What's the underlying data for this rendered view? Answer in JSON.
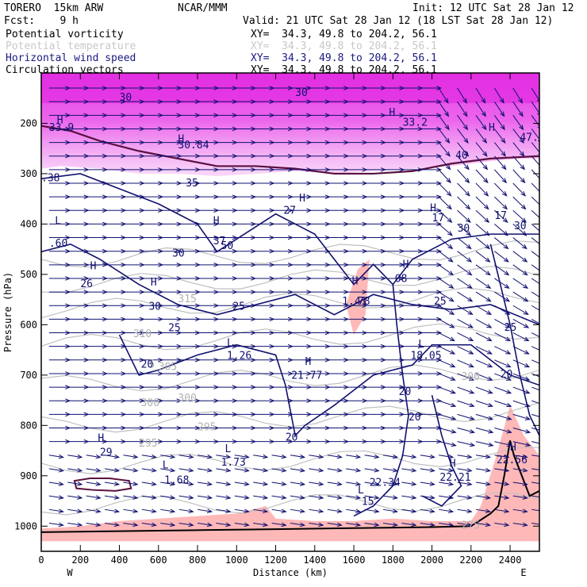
{
  "header": {
    "model": "TORERO  15km ARW",
    "fcst": "Fcst:    9 h",
    "center": "NCAR/MMM",
    "init": "Init: 12 UTC Sat 28 Jan 12",
    "valid": "Valid: 21 UTC Sat 28 Jan 12 (18 LST Sat 28 Jan 12)"
  },
  "legend": [
    {
      "label": "Potential vorticity",
      "xy": "XY=  34.3, 49.8 to 204.2, 56.1",
      "color": "#000000"
    },
    {
      "label": "Potential temperature",
      "xy": "XY=  34.3, 49.8 to 204.2, 56.1",
      "color": "#c8c8c8"
    },
    {
      "label": "Horizontal wind speed",
      "xy": "XY=  34.3, 49.8 to 204.2, 56.1",
      "color": "#1a1a80"
    },
    {
      "label": "Circulation vectors",
      "xy": "XY=  34.3, 49.8 to 204.2, 56.1",
      "color": "#000000"
    }
  ],
  "colors": {
    "pv_high": "#e020e0",
    "pv_low": "#ffb0b0",
    "wind": "#101070",
    "theta": "#c0c0c0",
    "terrain": "#000000"
  },
  "chart_data": {
    "type": "cross-section",
    "xlabel": "Distance (km)",
    "ylabel": "Pressure (hPa)",
    "xlim": [
      0,
      2550
    ],
    "ylim": [
      1050,
      100
    ],
    "x_ticks": [
      0,
      200,
      400,
      600,
      800,
      1000,
      1200,
      1400,
      1600,
      1800,
      2000,
      2200,
      2400
    ],
    "y_ticks": [
      200,
      300,
      400,
      500,
      600,
      700,
      800,
      900,
      1000
    ],
    "endpoint_left": "W",
    "endpoint_right": "E",
    "wind_contour_labels": [
      {
        "x": 400,
        "p": 155,
        "text": "30"
      },
      {
        "x": 1300,
        "p": 146,
        "text": "30"
      },
      {
        "x": 1850,
        "p": 205,
        "text": "33.2"
      },
      {
        "x": 40,
        "p": 215,
        "text": "33.9"
      },
      {
        "x": 700,
        "p": 250,
        "text": "30.84"
      },
      {
        "x": 2450,
        "p": 235,
        "text": "47.06"
      },
      {
        "x": 2120,
        "p": 270,
        "text": "40"
      },
      {
        "x": 0,
        "p": 315,
        "text": ".38"
      },
      {
        "x": 740,
        "p": 325,
        "text": "35"
      },
      {
        "x": 1240,
        "p": 380,
        "text": "27"
      },
      {
        "x": 2000,
        "p": 395,
        "text": "17"
      },
      {
        "x": 2320,
        "p": 390,
        "text": "17"
      },
      {
        "x": 2130,
        "p": 415,
        "text": "30"
      },
      {
        "x": 2420,
        "p": 410,
        "text": "30"
      },
      {
        "x": 40,
        "p": 445,
        "text": ".60"
      },
      {
        "x": 880,
        "p": 440,
        "text": "37"
      },
      {
        "x": 920,
        "p": 450,
        "text": "50"
      },
      {
        "x": 670,
        "p": 465,
        "text": "30"
      },
      {
        "x": 1810,
        "p": 515,
        "text": "08"
      },
      {
        "x": 200,
        "p": 525,
        "text": "26"
      },
      {
        "x": 1540,
        "p": 560,
        "text": "1.41"
      },
      {
        "x": 1620,
        "p": 560,
        "text": "78"
      },
      {
        "x": 980,
        "p": 570,
        "text": "25"
      },
      {
        "x": 550,
        "p": 570,
        "text": "30"
      },
      {
        "x": 2010,
        "p": 560,
        "text": "25"
      },
      {
        "x": 2370,
        "p": 612,
        "text": "25"
      },
      {
        "x": 650,
        "p": 613,
        "text": "25"
      },
      {
        "x": 950,
        "p": 668,
        "text": "1.26"
      },
      {
        "x": 1890,
        "p": 668,
        "text": "18.05"
      },
      {
        "x": 510,
        "p": 685,
        "text": "20"
      },
      {
        "x": 1280,
        "p": 707,
        "text": "21.77"
      },
      {
        "x": 2350,
        "p": 705,
        "text": "20"
      },
      {
        "x": 1830,
        "p": 740,
        "text": "20"
      },
      {
        "x": 1880,
        "p": 790,
        "text": "20"
      },
      {
        "x": 1250,
        "p": 830,
        "text": "20"
      },
      {
        "x": 300,
        "p": 860,
        "text": "29"
      },
      {
        "x": 920,
        "p": 880,
        "text": "1.73"
      },
      {
        "x": 630,
        "p": 915,
        "text": "1.68"
      },
      {
        "x": 2330,
        "p": 875,
        "text": "22.56"
      },
      {
        "x": 1680,
        "p": 920,
        "text": "22.34"
      },
      {
        "x": 2040,
        "p": 910,
        "text": "22.21"
      },
      {
        "x": 1640,
        "p": 958,
        "text": "15"
      }
    ],
    "theta_contour_labels": [
      {
        "x": 700,
        "p": 555,
        "text": "315"
      },
      {
        "x": 470,
        "p": 625,
        "text": "310"
      },
      {
        "x": 600,
        "p": 690,
        "text": "305"
      },
      {
        "x": 550,
        "p": 685,
        "text": "5"
      },
      {
        "x": 510,
        "p": 762,
        "text": "300"
      },
      {
        "x": 700,
        "p": 752,
        "text": "300"
      },
      {
        "x": 800,
        "p": 810,
        "text": "295"
      },
      {
        "x": 500,
        "p": 842,
        "text": "295"
      },
      {
        "x": 2150,
        "p": 710,
        "text": "300"
      },
      {
        "x": 2150,
        "p": 1005,
        "text": "275"
      }
    ],
    "extrema_labels": [
      {
        "x": 80,
        "p": 200,
        "text": "H"
      },
      {
        "x": 700,
        "p": 238,
        "text": "H"
      },
      {
        "x": 1780,
        "p": 185,
        "text": "H"
      },
      {
        "x": 2290,
        "p": 215,
        "text": "H"
      },
      {
        "x": 1320,
        "p": 355,
        "text": "H"
      },
      {
        "x": 1990,
        "p": 375,
        "text": "H"
      },
      {
        "x": 70,
        "p": 400,
        "text": "L"
      },
      {
        "x": 880,
        "p": 400,
        "text": "H"
      },
      {
        "x": 1850,
        "p": 487,
        "text": "H"
      },
      {
        "x": 250,
        "p": 490,
        "text": "H"
      },
      {
        "x": 1590,
        "p": 520,
        "text": "H"
      },
      {
        "x": 560,
        "p": 522,
        "text": "H"
      },
      {
        "x": 950,
        "p": 643,
        "text": "L"
      },
      {
        "x": 1930,
        "p": 645,
        "text": "L"
      },
      {
        "x": 1350,
        "p": 680,
        "text": "H"
      },
      {
        "x": 290,
        "p": 832,
        "text": "H"
      },
      {
        "x": 940,
        "p": 853,
        "text": "L"
      },
      {
        "x": 620,
        "p": 885,
        "text": "L"
      },
      {
        "x": 2400,
        "p": 850,
        "text": "H"
      },
      {
        "x": 2090,
        "p": 882,
        "text": "H"
      },
      {
        "x": 1620,
        "p": 935,
        "text": "L"
      }
    ]
  }
}
